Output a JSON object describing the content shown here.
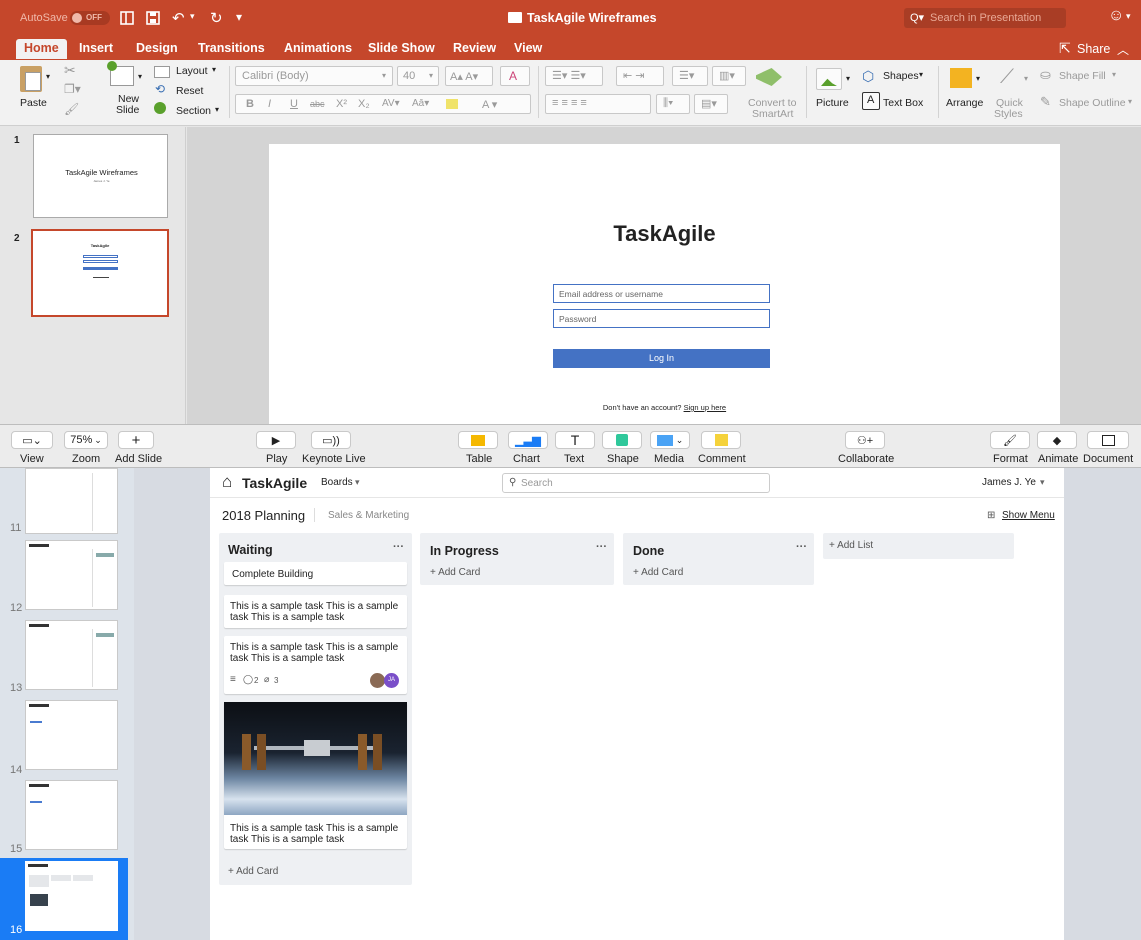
{
  "ppt": {
    "autosave_label": "AutoSave",
    "autosave_state": "OFF",
    "window_title": "TaskAgile Wireframes",
    "search_placeholder": "Search in Presentation",
    "tabs": [
      "Home",
      "Insert",
      "Design",
      "Transitions",
      "Animations",
      "Slide Show",
      "Review",
      "View"
    ],
    "share_label": "Share",
    "ribbon": {
      "paste": "Paste",
      "new_slide_1": "New",
      "new_slide_2": "Slide",
      "layout": "Layout",
      "reset": "Reset",
      "section": "Section",
      "font_name": "Calibri (Body)",
      "font_size": "40",
      "convert_1": "Convert to",
      "convert_2": "SmartArt",
      "picture": "Picture",
      "shapes": "Shapes",
      "text_box": "Text Box",
      "arrange": "Arrange",
      "quick_1": "Quick",
      "quick_2": "Styles",
      "shape_fill": "Shape Fill",
      "shape_outline": "Shape Outline"
    },
    "slides": [
      {
        "num": "1",
        "title": "TaskAgile Wireframes",
        "subtitle": "James J. Ye"
      },
      {
        "num": "2",
        "title": "TaskAgile"
      }
    ],
    "main_slide": {
      "title": "TaskAgile",
      "email_placeholder": "Email address or username",
      "password_placeholder": "Password",
      "login_label": "Log In",
      "signup_prefix": "Don't have an account?",
      "signup_link": "Sign up here"
    },
    "accent": "#c5472b"
  },
  "keynote": {
    "toolbar": {
      "view": "View",
      "zoom_value": "75%",
      "zoom": "Zoom",
      "add_slide": "Add Slide",
      "play": "Play",
      "keynote_live": "Keynote Live",
      "table": "Table",
      "chart": "Chart",
      "text": "Text",
      "shape": "Shape",
      "media": "Media",
      "comment": "Comment",
      "collaborate": "Collaborate",
      "format": "Format",
      "animate": "Animate",
      "document": "Document"
    },
    "slide_numbers": [
      "11",
      "12",
      "13",
      "14",
      "15",
      "16"
    ],
    "selected_slide": "16",
    "accent": "#1a7cf5"
  },
  "board": {
    "logo": "TaskAgile",
    "boards_menu": "Boards",
    "search_placeholder": "Search",
    "user_name": "James J. Ye",
    "board_name": "2018 Planning",
    "team_name": "Sales & Marketing",
    "show_menu": "Show Menu",
    "add_list": "+ Add List",
    "add_card": "+ Add Card",
    "lists": [
      {
        "title": "Waiting",
        "cards": [
          {
            "text": "Complete Building"
          },
          {
            "text_1": "This is a sample task This is a sample",
            "text_2": "task This is a sample task"
          },
          {
            "text_1": "This is a sample task This is a sample",
            "text_2": "task This is a sample task",
            "comments": "2",
            "attachments": "3",
            "avatar_initials": "JA"
          },
          {
            "text_1": "This is a sample task This is a sample",
            "text_2": "task This is a sample task"
          }
        ]
      },
      {
        "title": "In Progress"
      },
      {
        "title": "Done"
      }
    ]
  }
}
